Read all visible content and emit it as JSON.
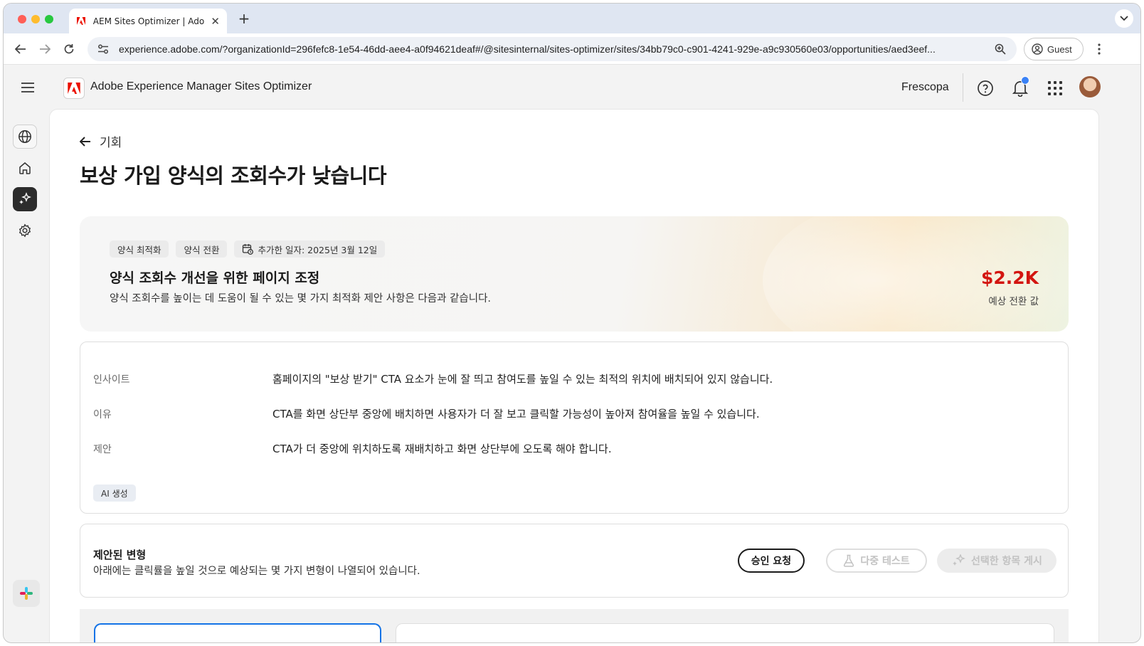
{
  "browser": {
    "tab_title": "AEM Sites Optimizer | Adobe",
    "url": "experience.adobe.com/?organizationId=296fefc8-1e54-46dd-aee4-a0f94621deaf#/@sitesinternal/sites-optimizer/sites/34bb79c0-c901-4241-929e-a9c930560e03/opportunities/aed3eef...",
    "profile_label": "Guest"
  },
  "header": {
    "app_title": "Adobe Experience Manager Sites Optimizer",
    "org_name": "Frescopa"
  },
  "page": {
    "back_label": "기회",
    "title": "보상 가입 양식의 조회수가 낮습니다"
  },
  "hero": {
    "chips": [
      "양식 최적화",
      "양식 전환"
    ],
    "date_chip": "추가한 일자: 2025년 3월 12일",
    "title": "양식 조회수 개선을 위한 페이지 조정",
    "description": "양식 조회수를 높이는 데 도움이 될 수 있는 몇 가지 최적화 제안 사항은 다음과 같습니다.",
    "value": "$2.2K",
    "value_label": "예상 전환 값"
  },
  "insights": {
    "rows": [
      {
        "label": "인사이트",
        "text": "홈페이지의 \"보상 받기\" CTA 요소가 눈에 잘 띄고 참여도를 높일 수 있는 최적의 위치에 배치되어 있지 않습니다."
      },
      {
        "label": "이유",
        "text": "CTA를 화면 상단부 중앙에 배치하면 사용자가 더 잘 보고 클릭할 가능성이 높아져 참여율을 높일 수 있습니다."
      },
      {
        "label": "제안",
        "text": "CTA가 더 중앙에 위치하도록 재배치하고 화면 상단부에 오도록 해야 합니다."
      }
    ],
    "ai_badge": "AI 생성"
  },
  "variations": {
    "title": "제안된 변형",
    "description": "아래에는 클릭률을 높일 것으로 예상되는 몇 가지 변형이 나열되어 있습니다.",
    "approve_label": "승인 요청",
    "multitest_label": "다중 테스트",
    "publish_label": "선택한 항목 게시"
  },
  "colors": {
    "accent_red": "#d31510",
    "selection_blue": "#1473e6",
    "notification_blue": "#3b82f6"
  }
}
